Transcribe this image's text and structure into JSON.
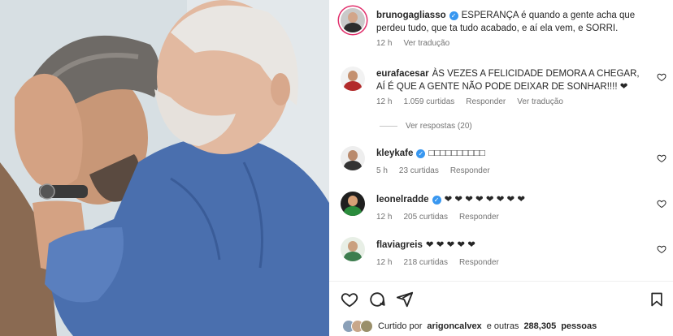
{
  "caption": {
    "username": "brunogagliasso",
    "text": "ESPERANÇA é quando a gente acha que perdeu tudo, que ta tudo acabado, e aí ela vem, e SORRI.",
    "time": "12 h",
    "translate": "Ver tradução"
  },
  "comments": [
    {
      "username": "eurafacesar",
      "text": "ÀS VEZES A FELICIDADE DEMORA A CHEGAR, AÍ É QUE A GENTE NÃO PODE DEIXAR DE SONHAR!!!! ❤",
      "time": "12 h",
      "likes": "1.059 curtidas",
      "reply": "Responder",
      "translate": "Ver tradução"
    },
    {
      "username": "kleykafe",
      "text": "□□□□□□□□□□",
      "time": "5 h",
      "likes": "23 curtidas",
      "reply": "Responder"
    },
    {
      "username": "leonelradde",
      "text": "❤ ❤ ❤ ❤ ❤ ❤ ❤ ❤",
      "time": "12 h",
      "likes": "205 curtidas",
      "reply": "Responder"
    },
    {
      "username": "flaviagreis",
      "text": "❤ ❤ ❤ ❤ ❤",
      "time": "12 h",
      "likes": "218 curtidas",
      "reply": "Responder"
    }
  ],
  "view_replies": "Ver respostas (20)",
  "liked_by": {
    "prefix": "Curtido por",
    "user": "arigoncalvex",
    "conj": "e outras",
    "count": "288,305",
    "suffix": "pessoas"
  },
  "icons": {
    "like": "heart-icon",
    "comment": "comment-icon",
    "share": "share-icon",
    "save": "bookmark-icon",
    "verified": "verified-badge-icon"
  },
  "colors": {
    "verified": "#3897f0",
    "heart": "#ed1c24",
    "meta": "#737373",
    "story_ring": "#e1306c"
  }
}
